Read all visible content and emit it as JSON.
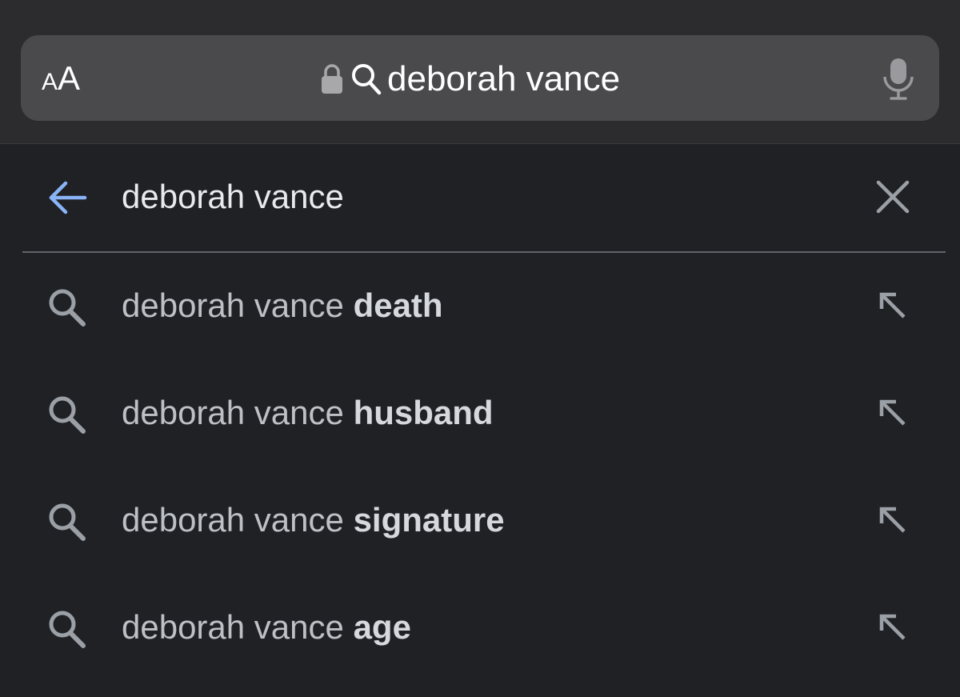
{
  "address_bar": {
    "aa_small": "A",
    "aa_large": "A",
    "url_text": "deborah vance",
    "lock_icon": "lock-icon",
    "search_icon": "search-icon",
    "mic_icon": "microphone-icon"
  },
  "search": {
    "query": "deborah vance",
    "back_icon": "arrow-left-icon",
    "clear_icon": "close-icon",
    "accent_color": "#8ab4f8"
  },
  "suggestions": [
    {
      "prefix": "deborah vance ",
      "completion": "death"
    },
    {
      "prefix": "deborah vance ",
      "completion": "husband"
    },
    {
      "prefix": "deborah vance ",
      "completion": "signature"
    },
    {
      "prefix": "deborah vance ",
      "completion": "age"
    }
  ],
  "colors": {
    "background": "#202124",
    "topbar": "#2c2c2e",
    "addressbar": "#4a4a4d",
    "suggestion_text": "#bdc1c6",
    "icon_gray": "#9aa0a6"
  }
}
